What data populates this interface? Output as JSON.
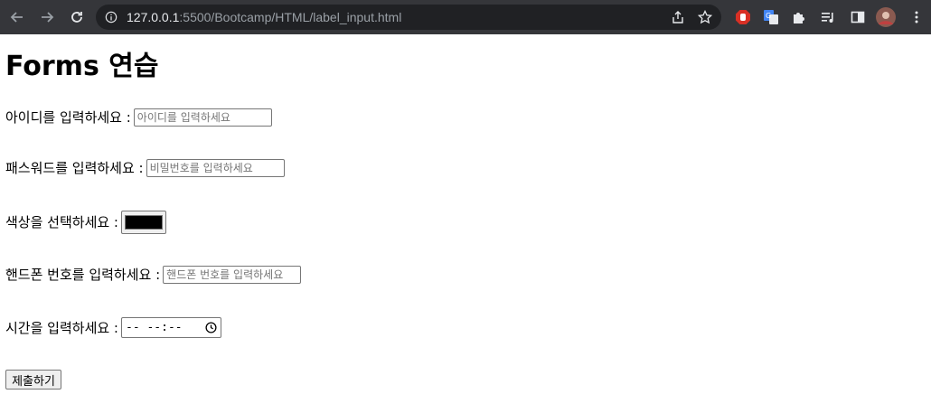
{
  "browser": {
    "url_host": "127.0.0.1",
    "url_path": ":5500/Bootcamp/HTML/label_input.html"
  },
  "page": {
    "title": "Forms 연습",
    "fields": {
      "id": {
        "label": "아이디를 입력하세요 :",
        "placeholder": "아이디를 입력하세요"
      },
      "password": {
        "label": "패스워드를 입력하세요 :",
        "placeholder": "비밀번호를 입력하세요"
      },
      "color": {
        "label": "색상을 선택하세요 :",
        "value": "#000000"
      },
      "phone": {
        "label": "핸드폰 번호를 입력하세요 :",
        "placeholder": "핸드폰 번호를 입력하세요"
      },
      "time": {
        "label": "시간을 입력하세요 :",
        "value": "-- --:--"
      }
    },
    "submit_label": "제출하기"
  }
}
